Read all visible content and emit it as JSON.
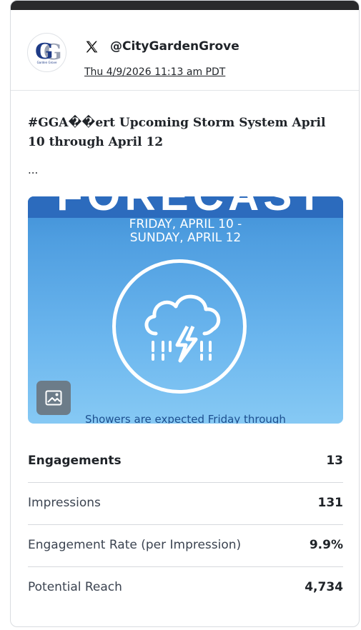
{
  "account": {
    "avatar_letters": "G",
    "avatar_subtext": "Garden Grove",
    "platform_icon": "x-logo-icon",
    "handle": "@CityGardenGrove",
    "timestamp": "Thu 4/9/2026 11:13 am PDT"
  },
  "post": {
    "text": "#GGA��ert Upcoming Storm System April 10 through April 12",
    "ellipsis": "...",
    "media": {
      "headline_partial": "FORECAST",
      "dates_line1": "FRIDAY, APRIL 10 -",
      "dates_line2": "SUNDAY, APRIL 12",
      "caption_partial": "Showers are expected Friday through",
      "icon": "thunderstorm-cloud-icon",
      "media_type_icon": "image-icon"
    }
  },
  "stats": [
    {
      "label": "Engagements",
      "value": "13"
    },
    {
      "label": "Impressions",
      "value": "131"
    },
    {
      "label": "Engagement Rate (per Impression)",
      "value": "9.9%"
    },
    {
      "label": "Potential Reach",
      "value": "4,734"
    }
  ]
}
